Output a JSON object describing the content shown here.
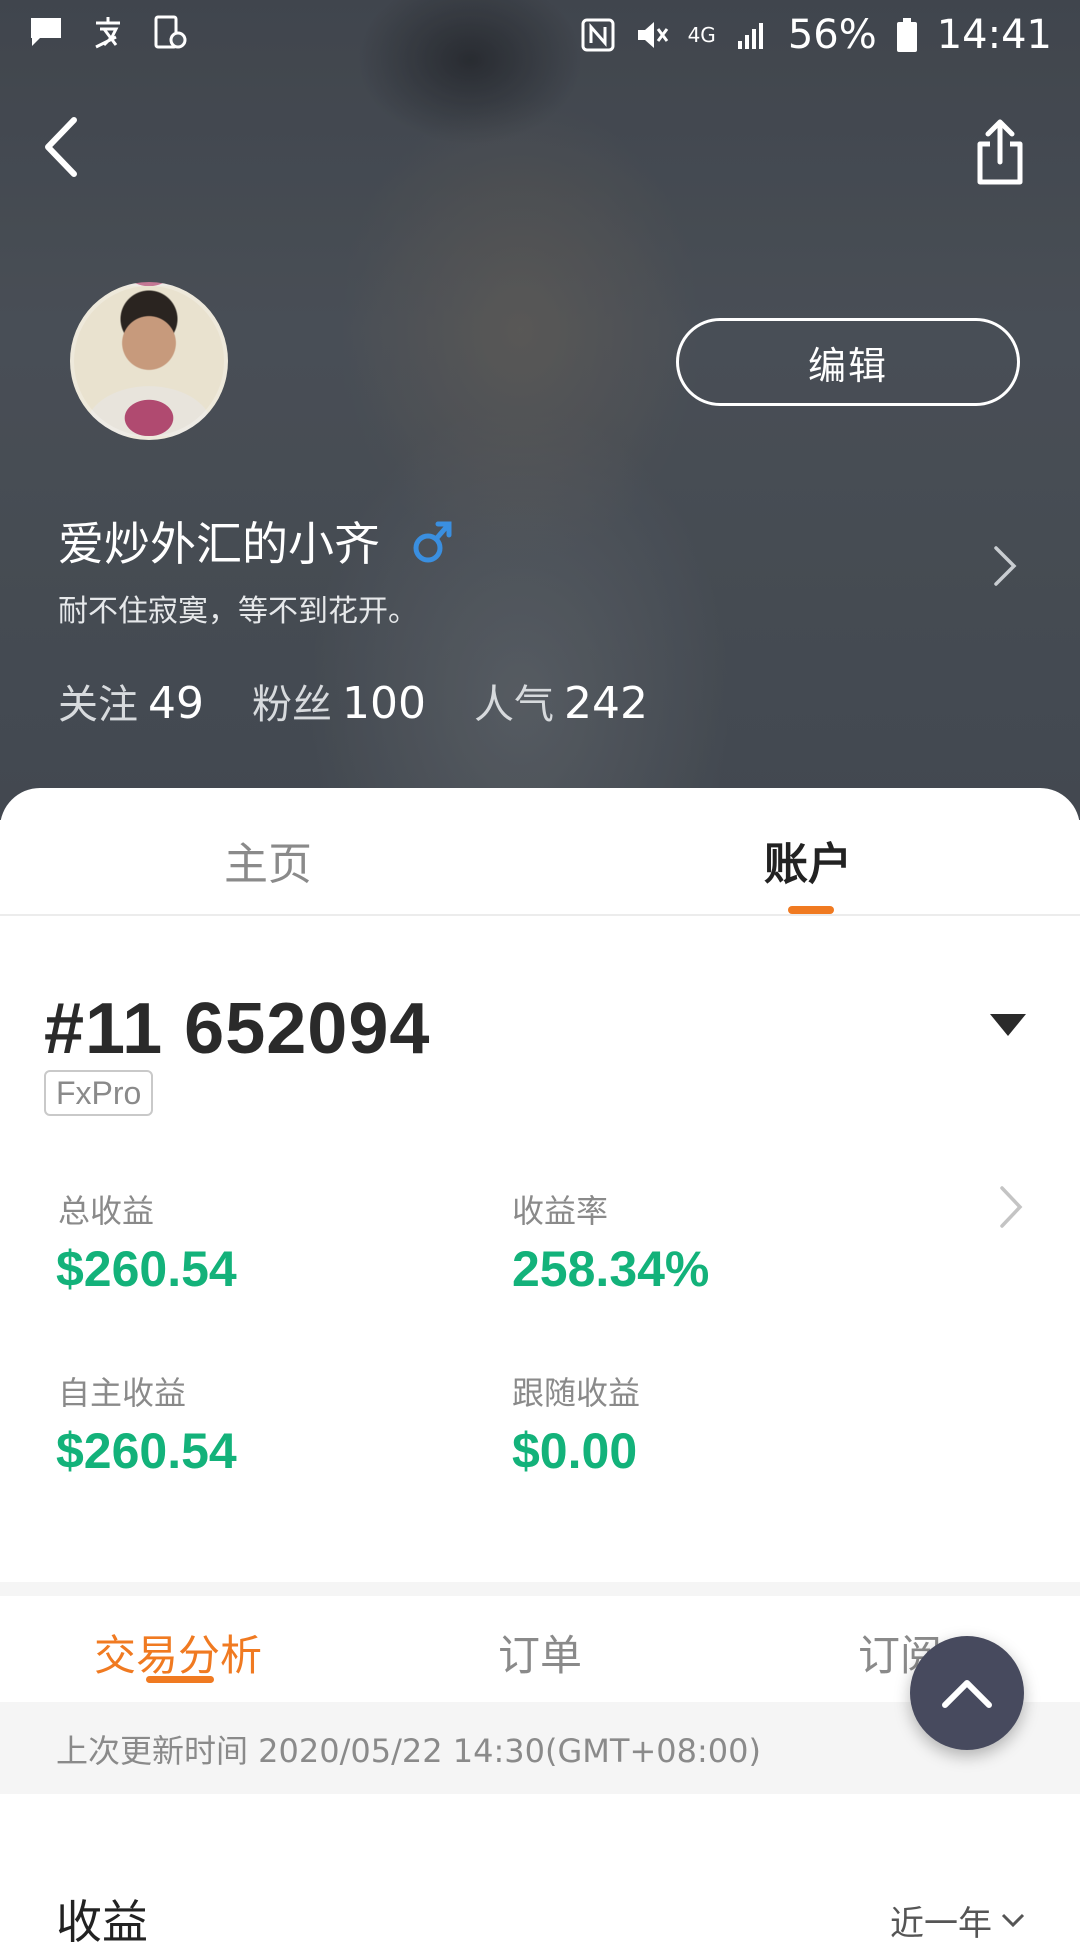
{
  "status_bar": {
    "network": "4G",
    "battery": "56%",
    "time": "14:41",
    "icons": [
      "message-icon",
      "alipay-icon",
      "battery-saver-icon",
      "nfc-icon",
      "mute-icon",
      "signal-icon",
      "battery-icon"
    ]
  },
  "nav": {
    "back_icon": "chevron-left-icon",
    "share_icon": "share-icon"
  },
  "profile": {
    "edit_label": "编辑",
    "username": "爱炒外汇的小齐",
    "gender": "♂",
    "bio": "耐不住寂寞，等不到花开。",
    "stats": [
      {
        "label": "关注",
        "value": "49"
      },
      {
        "label": "粉丝",
        "value": "100"
      },
      {
        "label": "人气",
        "value": "242"
      }
    ]
  },
  "tabs": [
    {
      "label": "主页",
      "active": false
    },
    {
      "label": "账户",
      "active": true
    }
  ],
  "account": {
    "number": "#11 652094",
    "broker": "FxPro",
    "metrics": [
      {
        "label": "总收益",
        "value": "$260.54"
      },
      {
        "label": "收益率",
        "value": "258.34%"
      },
      {
        "label": "自主收益",
        "value": "$260.54"
      },
      {
        "label": "跟随收益",
        "value": "$0.00"
      }
    ]
  },
  "sub_tabs": [
    {
      "label": "交易分析",
      "active": true
    },
    {
      "label": "订单",
      "active": false
    },
    {
      "label": "订阅",
      "active": false
    }
  ],
  "update_text": "上次更新时间 2020/05/22 14:30(GMT+08:00)",
  "earnings": {
    "title": "收益",
    "range": "近一年"
  },
  "colors": {
    "accent": "#f07a21",
    "profit": "#13b27a",
    "fab": "#474a5e"
  }
}
